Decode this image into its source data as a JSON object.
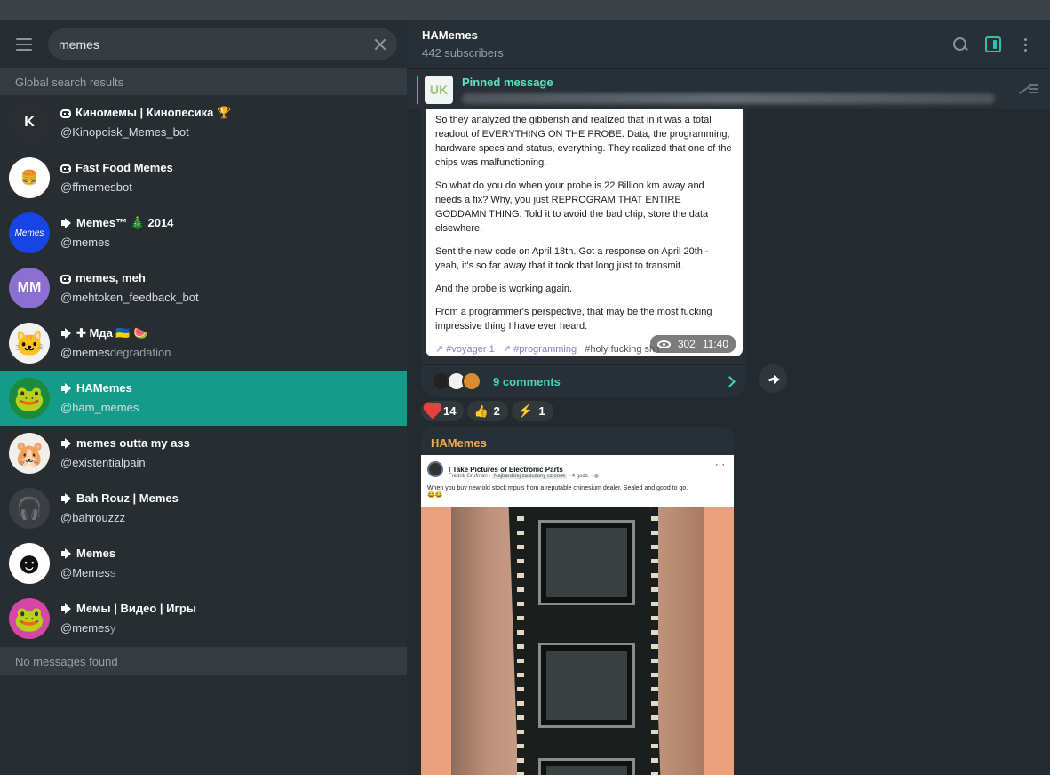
{
  "search": {
    "value": "memes",
    "section": "Global search results",
    "empty": "No messages found"
  },
  "results": [
    {
      "title": "Киномемы | Кинопесика 🏆",
      "username": "@Kinopoisk_Memes_bot",
      "type": "bot",
      "avatar_text": "K",
      "avatar_color": "#2a2d32"
    },
    {
      "title": "Fast Food Memes",
      "username": "@ffmemesbot",
      "type": "bot",
      "avatar_text": "🍔",
      "avatar_color": "#ffffff"
    },
    {
      "title": "Memes™ 🎄 2014",
      "username": "@memes",
      "type": "channel",
      "avatar_text": "Memes",
      "avatar_color": "#1744e3"
    },
    {
      "title": "memes, meh",
      "username": "@mehtoken_feedback_bot",
      "type": "bot",
      "avatar_text": "MM",
      "avatar_color": "#8b6fd1"
    },
    {
      "title": "✚ Мда 🇺🇦 🍉",
      "username_main": "@memes",
      "username_muted": "degradation",
      "type": "channel",
      "avatar_text": "🐱",
      "avatar_color": "#f2f2f2"
    },
    {
      "title": "HAMemes",
      "username": "@ham_memes",
      "type": "channel",
      "avatar_text": "🐸",
      "avatar_color": "#1c8a3d"
    },
    {
      "title": "memes outta my ass",
      "username": "@existentialpain",
      "type": "channel",
      "avatar_text": "🐹",
      "avatar_color": "#f1efe9"
    },
    {
      "title": "Bah Rouz | Memes",
      "username": "@bahrouzzz",
      "type": "channel",
      "avatar_text": "🎧",
      "avatar_color": "#3b3f44"
    },
    {
      "title": "Memes",
      "username_main": "@Memes",
      "username_muted": "s",
      "type": "channel",
      "avatar_text": "☻",
      "avatar_color": "#ffffff"
    },
    {
      "title": "Мемы | Видео | Игры",
      "username_main": "@memes",
      "username_muted": "y",
      "type": "channel",
      "avatar_text": "🐸",
      "avatar_color": "#d447a6"
    }
  ],
  "chat": {
    "title": "HAMemes",
    "subscribers": "442 subscribers",
    "pinned_title": "Pinned message",
    "pinned_thumb": "UK",
    "message": {
      "paragraphs": [
        "So they analyzed the gibberish and realized that in it was a total readout of EVERYTHING ON THE PROBE. Data, the programming, hardware specs and status, everything. They realized that one of the chips was malfunctioning.",
        "So what do you do when your probe is 22 Billion km away and needs a fix? Why, you just REPROGRAM THAT ENTIRE GODDAMN THING. Told it to avoid the bad chip, store the data elsewhere.",
        "Sent the new code on April 18th. Got a response on April 20th - yeah, it's so far away that it took that long just to transmit.",
        "And the probe is working again.",
        "From a programmer's perspective, that may be the most fucking impressive thing I have ever heard."
      ],
      "tag1": "↗ #voyager 1",
      "tag2": "↗ #programming",
      "tag3": "#holy fucking shit",
      "views": "302",
      "time": "11:40",
      "comments": "9 comments"
    },
    "reactions": [
      {
        "emoji": "heart",
        "count": "14"
      },
      {
        "emoji": "👍",
        "count": "2"
      },
      {
        "emoji": "⚡",
        "count": "1"
      }
    ],
    "second_post": {
      "author": "HAMemes",
      "group": "I Take Pictures of Electronic Parts",
      "poster": "Fredrik Grufman",
      "badge": "Najbardziej zasłużony członek",
      "age": "· 4 godz. · ◍",
      "caption": "When you buy new old stock mpu's from a reputable chinesium dealer. Sealed and good to go.",
      "emoji": "😂😂"
    }
  }
}
